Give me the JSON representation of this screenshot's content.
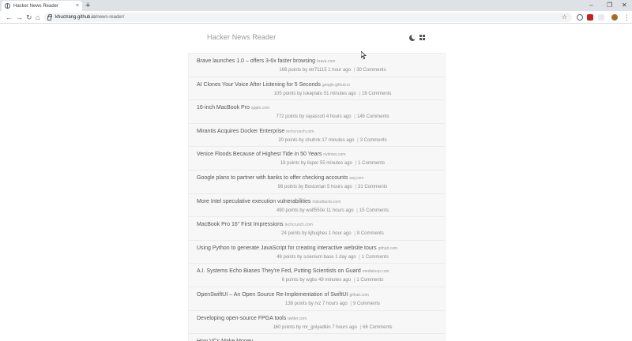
{
  "browser": {
    "tab_title": "Hacker News Reader",
    "url_host": "khuctrang.github.io",
    "url_path": "/news-reader/",
    "new_tab_glyph": "+",
    "close_glyph": "×"
  },
  "header": {
    "title": "Hacker News Reader",
    "theme_toggle_icon": "moon-icon",
    "layout_toggle_icon": "grid-icon"
  },
  "stories": [
    {
      "title": "Brave launches 1.0 – offers 3-6x faster browsing",
      "domain": "brave.com",
      "points": "166 points",
      "author": "etr71115",
      "age": "1 hour ago",
      "comments": "30 Comments"
    },
    {
      "title": "AI Clones Your Voice After Listening for 5 Seconds",
      "domain": "google.github.io",
      "points": "105 points",
      "author": "lukeplato",
      "age": "51 minutes ago",
      "comments": "16 Comments"
    },
    {
      "title": "16-inch MacBook Pro",
      "domain": "apple.com",
      "points": "772 points",
      "author": "rayascott",
      "age": "4 hours ago",
      "comments": "146 Comments"
    },
    {
      "title": "Mirantis Acquires Docker Enterprise",
      "domain": "techcrunch.com",
      "points": "20 points",
      "author": "chuhnk",
      "age": "17 minutes ago",
      "comments": "3 Comments"
    },
    {
      "title": "Venice Floods Because of Highest Tide in 50 Years",
      "domain": "nytimes.com",
      "points": "19 points",
      "author": "lisper",
      "age": "55 minutes ago",
      "comments": "1 Comments"
    },
    {
      "title": "Google plans to partner with banks to offer checking accounts",
      "domain": "wsj.com",
      "points": "98 points",
      "author": "Bostonian",
      "age": "5 hours ago",
      "comments": "31 Comments"
    },
    {
      "title": "More Intel speculative execution vulnerabilities",
      "domain": "mdsattacks.com",
      "points": "490 points",
      "author": "wolf550e",
      "age": "11 hours ago",
      "comments": "15 Comments"
    },
    {
      "title": "MacBook Pro 16\" First Impressions",
      "domain": "techcrunch.com",
      "points": "24 points",
      "author": "kjhughes",
      "age": "1 hour ago",
      "comments": "8 Comments"
    },
    {
      "title": "Using Python to generate JavaScript for creating interactive website tours",
      "domain": "github.com",
      "points": "48 points",
      "author": "scienium base",
      "age": "1 day ago",
      "comments": "1 Comments"
    },
    {
      "title": "A.I. Systems Echo Biases They're Fed, Putting Scientists on Guard",
      "domain": "medialoop.com",
      "points": "6 points",
      "author": "wgbs",
      "age": "49 minutes ago",
      "comments": "1 Comments"
    },
    {
      "title": "OpenSwiftUI – An Open Source Re-Implementation of SwiftUI",
      "domain": "github.com",
      "points": "138 points",
      "author": "rvz",
      "age": "7 hours ago",
      "comments": "9 Comments"
    },
    {
      "title": "Developing open-source FPGA tools",
      "domain": "twitter.com",
      "points": "160 points",
      "author": "mr_golyadkin",
      "age": "7 hours ago",
      "comments": "66 Comments"
    },
    {
      "title": "How VCs Make Money",
      "domain": "",
      "points": "",
      "author": "",
      "age": "",
      "comments": ""
    }
  ],
  "meta_words": {
    "by": "by",
    "separator": "|"
  },
  "extensions": {
    "colors": [
      "#5f6368",
      "#c5221f",
      "#e8eaed",
      "#a56a2a"
    ]
  }
}
